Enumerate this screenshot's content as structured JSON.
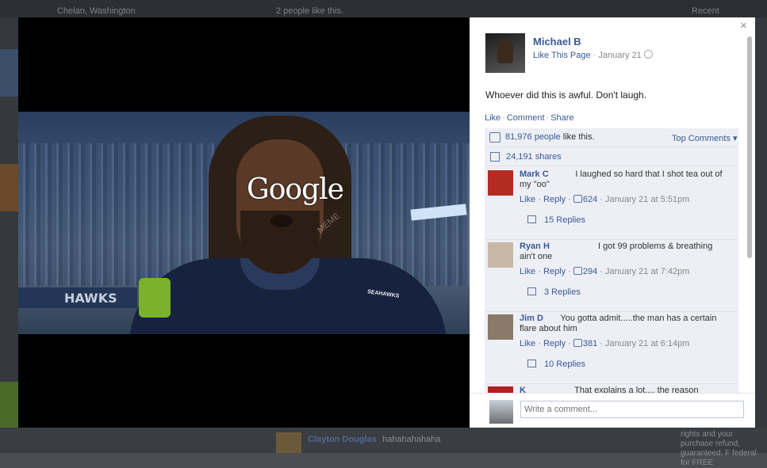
{
  "background": {
    "location": "Chelan, Washington",
    "likes_note": "2 people like this.",
    "recent": "Recent",
    "comment_name": "Clayton Douglas",
    "comment_text": "hahahahahaha",
    "side_text": "rights and your purchase refund, guaranteed. F federal for FREE"
  },
  "photo": {
    "logo_text": "Google",
    "jersey_text": "SEAHAWKS",
    "banner_text": "HAWKS"
  },
  "post": {
    "author": "Michael B",
    "like_page": "Like This Page",
    "date": "January 21",
    "text": "Whoever did this is awful. Don't laugh.",
    "actions": {
      "like": "Like",
      "comment": "Comment",
      "share": "Share"
    },
    "likes_count": "81,976 people",
    "likes_suffix": "like this.",
    "top_comments": "Top Comments ▾",
    "shares": "24,191 shares"
  },
  "comments": [
    {
      "name": "Mark C",
      "text": "I laughed so hard that I shot tea out of my \"oo\"",
      "like": "Like",
      "reply": "Reply",
      "likes": "624",
      "time": "January 21 at 5:51pm",
      "replies": "15 Replies",
      "avatar_color": "#b42b22"
    },
    {
      "name": "Ryan H",
      "text": "I got 99 problems & breathing ain't one",
      "like": "Like",
      "reply": "Reply",
      "likes": "294",
      "time": "January 21 at 7:42pm",
      "replies": "3 Replies",
      "avatar_color": "#c9b8a6"
    },
    {
      "name": "Jim D",
      "text": "You gotta admit.....the man has a certain flare about him",
      "like": "Like",
      "reply": "Reply",
      "likes": "381",
      "time": "January 21 at 6:14pm",
      "replies": "10 Replies",
      "avatar_color": "#8a7a68"
    },
    {
      "name": "K",
      "text": "That explains a lot.... the reason",
      "avatar_color": "#b51f1f"
    }
  ],
  "composer": {
    "placeholder": "Write a comment..."
  },
  "close_label": "×"
}
